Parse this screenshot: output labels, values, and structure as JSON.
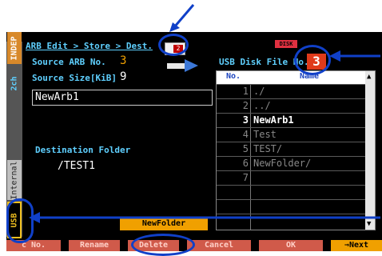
{
  "header": {
    "breadcrumb": "ARB Edit > Store > Dest.",
    "disk_badge": "DISK",
    "store_icon_badge": "2"
  },
  "side_tabs": {
    "indep": "INDEP",
    "channel": "2ch",
    "internal": "Internal",
    "usb": "USB"
  },
  "source": {
    "arb_no_label": "Source ARB No.",
    "arb_no_value": "3",
    "size_label": "Source Size[KiB]",
    "size_value": "9",
    "name_value": "NewArb1"
  },
  "destination": {
    "label": "Destination Folder",
    "path": "/TEST1"
  },
  "usb_file": {
    "label": "USB Disk File No.",
    "value": "3"
  },
  "file_table": {
    "columns": [
      "No.",
      "Name"
    ],
    "rows": [
      {
        "no": "1",
        "name": "./"
      },
      {
        "no": "2",
        "name": "../"
      },
      {
        "no": "3",
        "name": "NewArb1"
      },
      {
        "no": "4",
        "name": "Test"
      },
      {
        "no": "5",
        "name": "TEST/"
      },
      {
        "no": "6",
        "name": "NewFolder/"
      },
      {
        "no": "7",
        "name": ""
      },
      {
        "no": "",
        "name": ""
      },
      {
        "no": "",
        "name": ""
      },
      {
        "no": "",
        "name": ""
      }
    ],
    "selected_row": 3
  },
  "new_folder_label": "NewFolder",
  "softkeys": [
    "c No.",
    "Rename",
    "Delete",
    "Cancel",
    "OK",
    "⇒Next"
  ],
  "colors": {
    "label_cyan": "#5fd0ff",
    "softkey_red": "#d05a4a",
    "softkey_orange": "#f0a000",
    "annotation_blue": "#1040c8"
  }
}
